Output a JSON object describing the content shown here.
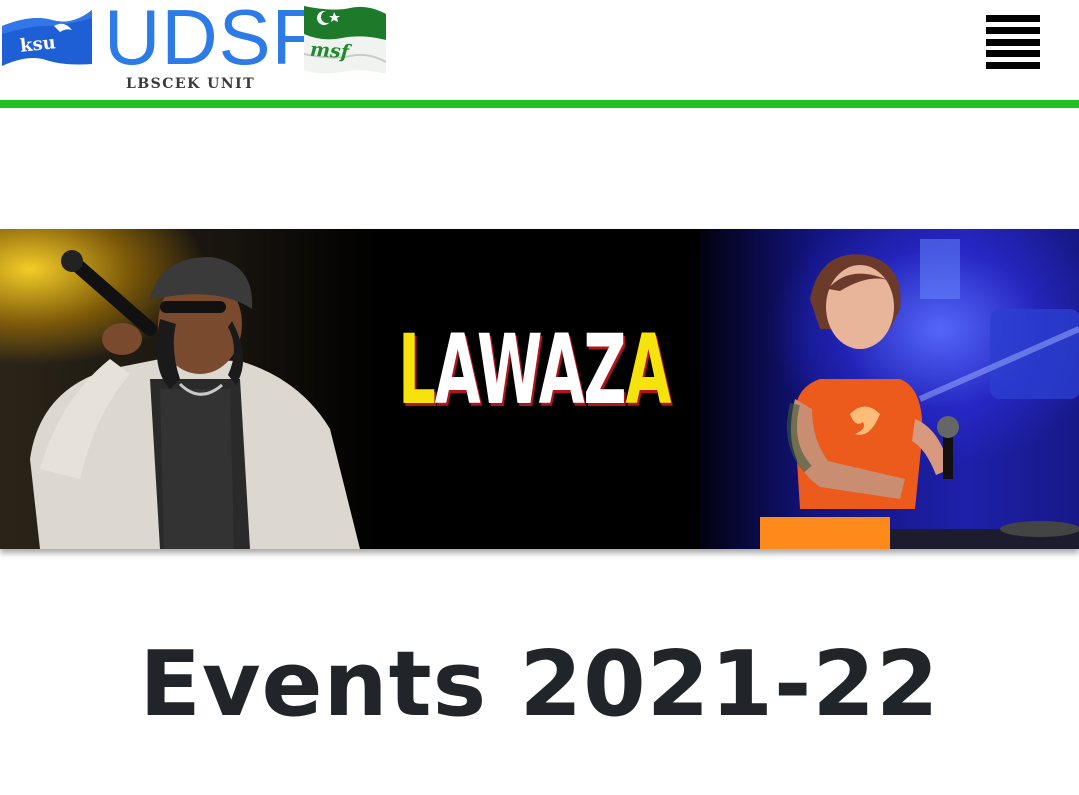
{
  "header": {
    "logo": {
      "wordmark": "UDSF",
      "subtitle": "LBSCEK UNIT",
      "flag_left_text": "ksu",
      "flag_right_text": "msf",
      "wordmark_color": "#2d7be6"
    },
    "menu_icon": "hamburger-menu-icon",
    "accent_color": "#1fc01f"
  },
  "banner": {
    "title_parts": [
      {
        "text": "L",
        "color": "#f6e20c"
      },
      {
        "text": "AWAZ",
        "color": "#ffffff"
      },
      {
        "text": "A",
        "color": "#f6e20c"
      }
    ]
  },
  "main": {
    "title": "Events 2021-22"
  }
}
